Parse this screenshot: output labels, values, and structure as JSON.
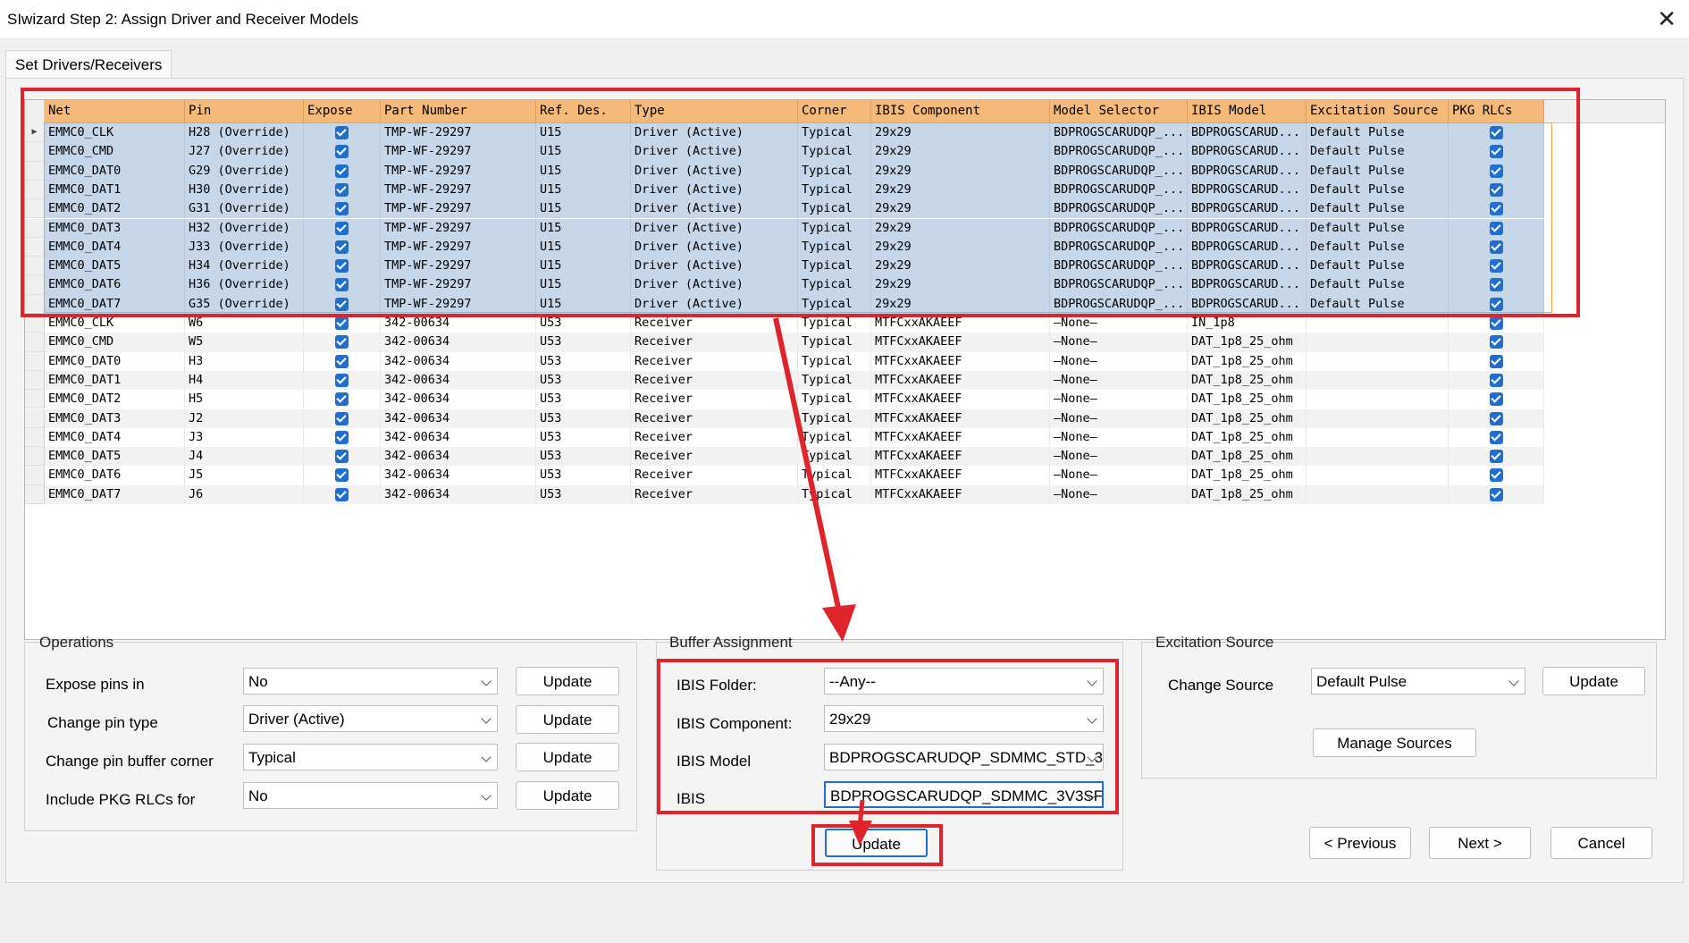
{
  "window": {
    "title": "SIwizard Step 2: Assign Driver and Receiver Models",
    "close_glyph": "✕"
  },
  "tab": {
    "label": "Set Drivers/Receivers"
  },
  "grid": {
    "columns": [
      "Net",
      "Pin",
      "Expose",
      "Part Number",
      "Ref. Des.",
      "Type",
      "Corner",
      "IBIS Component",
      "Model Selector",
      "IBIS Model",
      "Excitation Source",
      "PKG RLCs"
    ],
    "row_indicator": "▶",
    "rows": [
      {
        "net": "EMMC0_CLK",
        "pin": "H28 (Override)",
        "part": "TMP-WF-29297",
        "ref": "U15",
        "type": "Driver (Active)",
        "corner": "Typical",
        "comp": "29x29",
        "selector": "BDPROGSCARUDQP_...",
        "model": "BDPROGSCARUD...",
        "exc": "Default Pulse",
        "selected": true
      },
      {
        "net": "EMMC0_CMD",
        "pin": "J27 (Override)",
        "part": "TMP-WF-29297",
        "ref": "U15",
        "type": "Driver (Active)",
        "corner": "Typical",
        "comp": "29x29",
        "selector": "BDPROGSCARUDQP_...",
        "model": "BDPROGSCARUD...",
        "exc": "Default Pulse",
        "selected": true
      },
      {
        "net": "EMMC0_DAT0",
        "pin": "G29 (Override)",
        "part": "TMP-WF-29297",
        "ref": "U15",
        "type": "Driver (Active)",
        "corner": "Typical",
        "comp": "29x29",
        "selector": "BDPROGSCARUDQP_...",
        "model": "BDPROGSCARUD...",
        "exc": "Default Pulse",
        "selected": true
      },
      {
        "net": "EMMC0_DAT1",
        "pin": "H30 (Override)",
        "part": "TMP-WF-29297",
        "ref": "U15",
        "type": "Driver (Active)",
        "corner": "Typical",
        "comp": "29x29",
        "selector": "BDPROGSCARUDQP_...",
        "model": "BDPROGSCARUD...",
        "exc": "Default Pulse",
        "selected": true
      },
      {
        "net": "EMMC0_DAT2",
        "pin": "G31 (Override)",
        "part": "TMP-WF-29297",
        "ref": "U15",
        "type": "Driver (Active)",
        "corner": "Typical",
        "comp": "29x29",
        "selector": "BDPROGSCARUDQP_...",
        "model": "BDPROGSCARUD...",
        "exc": "Default Pulse",
        "selected": true
      },
      {
        "net": "EMMC0_DAT3",
        "pin": "H32 (Override)",
        "part": "TMP-WF-29297",
        "ref": "U15",
        "type": "Driver (Active)",
        "corner": "Typical",
        "comp": "29x29",
        "selector": "BDPROGSCARUDQP_...",
        "model": "BDPROGSCARUD...",
        "exc": "Default Pulse",
        "selected": true
      },
      {
        "net": "EMMC0_DAT4",
        "pin": "J33 (Override)",
        "part": "TMP-WF-29297",
        "ref": "U15",
        "type": "Driver (Active)",
        "corner": "Typical",
        "comp": "29x29",
        "selector": "BDPROGSCARUDQP_...",
        "model": "BDPROGSCARUD...",
        "exc": "Default Pulse",
        "selected": true
      },
      {
        "net": "EMMC0_DAT5",
        "pin": "H34 (Override)",
        "part": "TMP-WF-29297",
        "ref": "U15",
        "type": "Driver (Active)",
        "corner": "Typical",
        "comp": "29x29",
        "selector": "BDPROGSCARUDQP_...",
        "model": "BDPROGSCARUD...",
        "exc": "Default Pulse",
        "selected": true
      },
      {
        "net": "EMMC0_DAT6",
        "pin": "H36 (Override)",
        "part": "TMP-WF-29297",
        "ref": "U15",
        "type": "Driver (Active)",
        "corner": "Typical",
        "comp": "29x29",
        "selector": "BDPROGSCARUDQP_...",
        "model": "BDPROGSCARUD...",
        "exc": "Default Pulse",
        "selected": true
      },
      {
        "net": "EMMC0_DAT7",
        "pin": "G35 (Override)",
        "part": "TMP-WF-29297",
        "ref": "U15",
        "type": "Driver (Active)",
        "corner": "Typical",
        "comp": "29x29",
        "selector": "BDPROGSCARUDQP_...",
        "model": "BDPROGSCARUD...",
        "exc": "Default Pulse",
        "selected": true
      },
      {
        "net": "EMMC0_CLK",
        "pin": "W6",
        "part": "342-00634",
        "ref": "U53",
        "type": "Receiver",
        "corner": "Typical",
        "comp": "MTFCxxAKAEEF",
        "selector": "—None—",
        "model": "IN_1p8",
        "exc": "",
        "selected": false
      },
      {
        "net": "EMMC0_CMD",
        "pin": "W5",
        "part": "342-00634",
        "ref": "U53",
        "type": "Receiver",
        "corner": "Typical",
        "comp": "MTFCxxAKAEEF",
        "selector": "—None—",
        "model": "DAT_1p8_25_ohm",
        "exc": "",
        "selected": false
      },
      {
        "net": "EMMC0_DAT0",
        "pin": "H3",
        "part": "342-00634",
        "ref": "U53",
        "type": "Receiver",
        "corner": "Typical",
        "comp": "MTFCxxAKAEEF",
        "selector": "—None—",
        "model": "DAT_1p8_25_ohm",
        "exc": "",
        "selected": false
      },
      {
        "net": "EMMC0_DAT1",
        "pin": "H4",
        "part": "342-00634",
        "ref": "U53",
        "type": "Receiver",
        "corner": "Typical",
        "comp": "MTFCxxAKAEEF",
        "selector": "—None—",
        "model": "DAT_1p8_25_ohm",
        "exc": "",
        "selected": false
      },
      {
        "net": "EMMC0_DAT2",
        "pin": "H5",
        "part": "342-00634",
        "ref": "U53",
        "type": "Receiver",
        "corner": "Typical",
        "comp": "MTFCxxAKAEEF",
        "selector": "—None—",
        "model": "DAT_1p8_25_ohm",
        "exc": "",
        "selected": false
      },
      {
        "net": "EMMC0_DAT3",
        "pin": "J2",
        "part": "342-00634",
        "ref": "U53",
        "type": "Receiver",
        "corner": "Typical",
        "comp": "MTFCxxAKAEEF",
        "selector": "—None—",
        "model": "DAT_1p8_25_ohm",
        "exc": "",
        "selected": false
      },
      {
        "net": "EMMC0_DAT4",
        "pin": "J3",
        "part": "342-00634",
        "ref": "U53",
        "type": "Receiver",
        "corner": "Typical",
        "comp": "MTFCxxAKAEEF",
        "selector": "—None—",
        "model": "DAT_1p8_25_ohm",
        "exc": "",
        "selected": false
      },
      {
        "net": "EMMC0_DAT5",
        "pin": "J4",
        "part": "342-00634",
        "ref": "U53",
        "type": "Receiver",
        "corner": "Typical",
        "comp": "MTFCxxAKAEEF",
        "selector": "—None—",
        "model": "DAT_1p8_25_ohm",
        "exc": "",
        "selected": false
      },
      {
        "net": "EMMC0_DAT6",
        "pin": "J5",
        "part": "342-00634",
        "ref": "U53",
        "type": "Receiver",
        "corner": "Typical",
        "comp": "MTFCxxAKAEEF",
        "selector": "—None—",
        "model": "DAT_1p8_25_ohm",
        "exc": "",
        "selected": false
      },
      {
        "net": "EMMC0_DAT7",
        "pin": "J6",
        "part": "342-00634",
        "ref": "U53",
        "type": "Receiver",
        "corner": "Typical",
        "comp": "MTFCxxAKAEEF",
        "selector": "—None—",
        "model": "DAT_1p8_25_ohm",
        "exc": "",
        "selected": false
      }
    ]
  },
  "operations": {
    "title": "Operations",
    "expose": {
      "label": "Expose pins in",
      "value": "No",
      "button": "Update"
    },
    "pin_type": {
      "label": "Change pin type",
      "value": "Driver (Active)",
      "button": "Update"
    },
    "corner": {
      "label": "Change pin buffer corner",
      "value": "Typical",
      "button": "Update"
    },
    "pkg": {
      "label": "Include PKG RLCs for",
      "value": "No",
      "button": "Update"
    }
  },
  "buffer": {
    "title": "Buffer Assignment",
    "folder": {
      "label": "IBIS Folder:",
      "value": "--Any--"
    },
    "component": {
      "label": "IBIS Component:",
      "value": "29x29"
    },
    "model": {
      "label": "IBIS Model",
      "value": "BDPROGSCARUDQP_SDMMC_STD_3'"
    },
    "ibis": {
      "label": "IBIS",
      "value": "BDPROGSCARUDQP_SDMMC_3V3SF_"
    },
    "button": "Update"
  },
  "excitation": {
    "title": "Excitation Source",
    "label": "Change Source",
    "value": "Default Pulse",
    "update_button": "Update",
    "manage_button": "Manage Sources"
  },
  "nav": {
    "previous": "< Previous",
    "next": "Next >",
    "cancel": "Cancel"
  },
  "colors": {
    "header": "#f5b979",
    "selection": "#c7d7ea",
    "annotation_red": "#e0242b",
    "check_blue": "#1f6fd0"
  }
}
